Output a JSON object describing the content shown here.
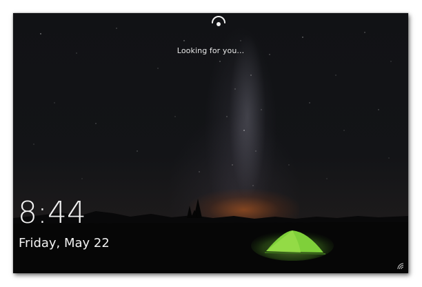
{
  "lockscreen": {
    "status_text": "Looking for you...",
    "time": "8:44",
    "date": "Friday, May 22"
  },
  "icons": {
    "face_recognition": "face-recognition-icon",
    "network": "wifi-icon"
  },
  "colors": {
    "text": "#f2f2f2",
    "sky": "#111215",
    "horizon_glow": "#cd5f19",
    "tent_green": "#7fd03a"
  }
}
